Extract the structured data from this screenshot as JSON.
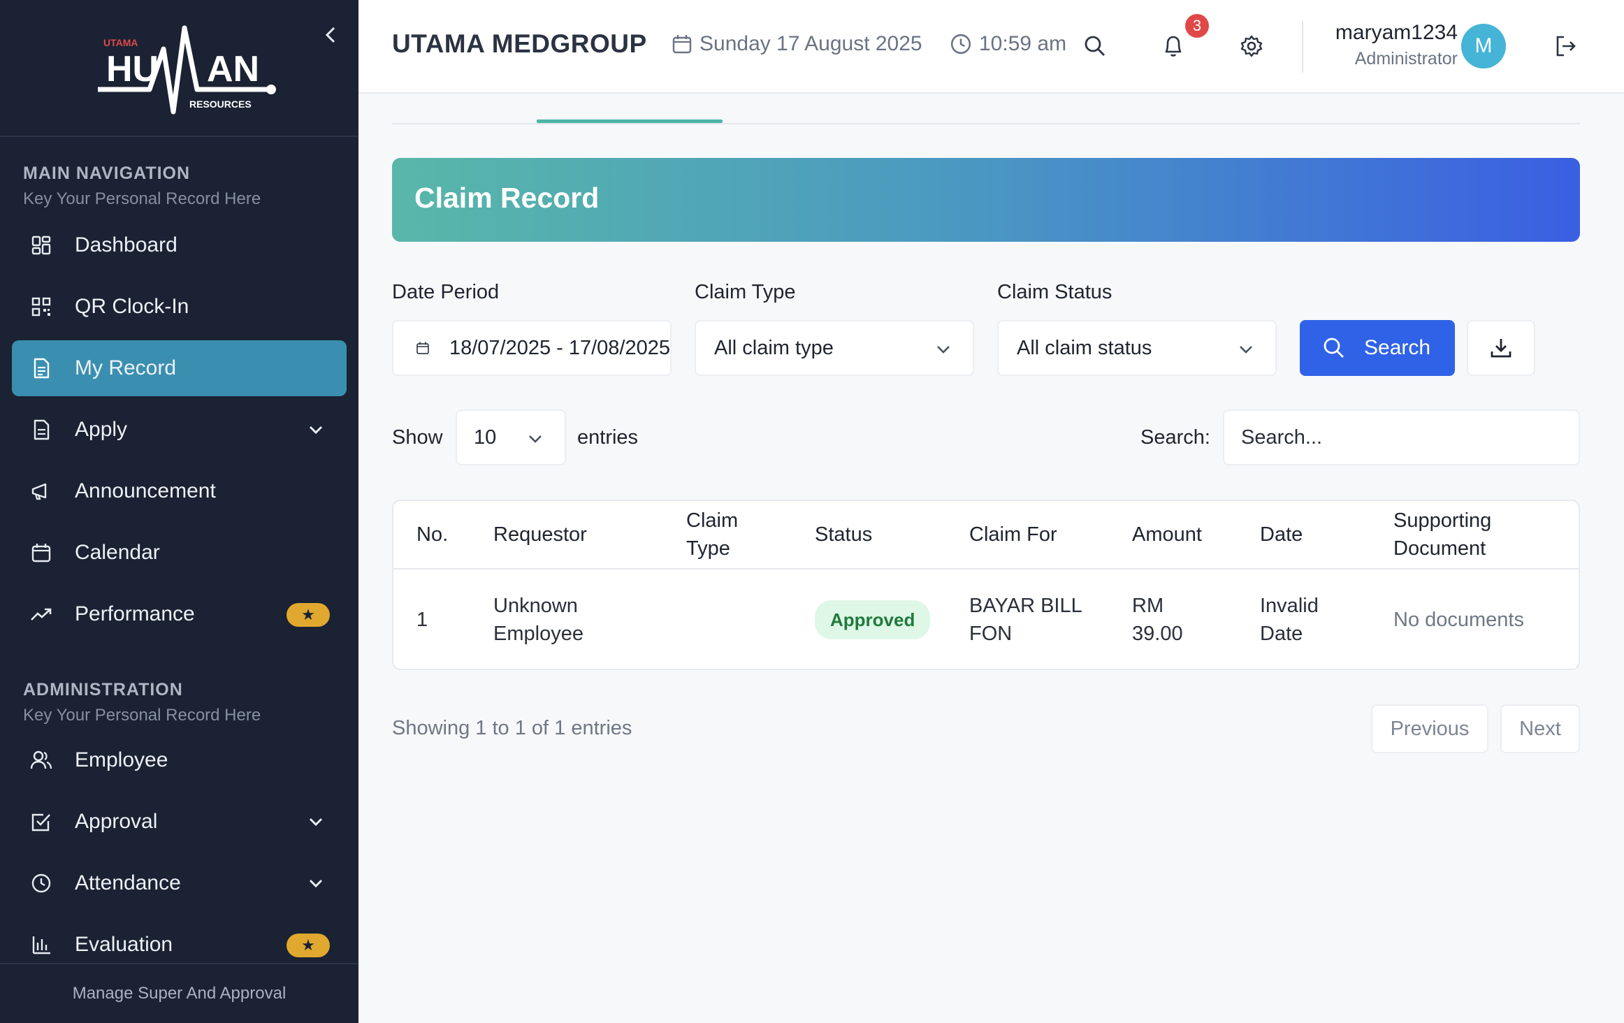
{
  "sidebar": {
    "logo": {
      "small": "UTAMA",
      "main": "HUMAN",
      "sub": "RESOURCES"
    },
    "main_nav": {
      "title": "MAIN NAVIGATION",
      "subtitle": "Key Your Personal Record Here",
      "items": [
        {
          "label": "Dashboard",
          "icon": "dashboard-icon"
        },
        {
          "label": "QR Clock-In",
          "icon": "qr-code-icon"
        },
        {
          "label": "My Record",
          "icon": "document-icon",
          "active": true
        },
        {
          "label": "Apply",
          "icon": "form-icon",
          "expandable": true
        },
        {
          "label": "Announcement",
          "icon": "megaphone-icon"
        },
        {
          "label": "Calendar",
          "icon": "calendar-icon"
        },
        {
          "label": "Performance",
          "icon": "trend-up-icon",
          "badge": "star"
        }
      ]
    },
    "admin_nav": {
      "title": "ADMINISTRATION",
      "subtitle": "Key Your Personal Record Here",
      "items": [
        {
          "label": "Employee",
          "icon": "users-icon"
        },
        {
          "label": "Approval",
          "icon": "checkbox-icon",
          "expandable": true
        },
        {
          "label": "Attendance",
          "icon": "clock-icon",
          "expandable": true
        },
        {
          "label": "Evaluation",
          "icon": "bar-chart-icon",
          "badge": "star"
        }
      ]
    },
    "footer": "Manage Super And Approval"
  },
  "header": {
    "brand": "UTAMA MEDGROUP",
    "date": "Sunday 17 August 2025",
    "time": "10:59 am",
    "notification_count": "3",
    "user": {
      "name": "maryam1234",
      "role": "Administrator",
      "initial": "M"
    }
  },
  "page": {
    "title": "Claim Record",
    "filters": {
      "date_period_label": "Date Period",
      "date_period_value": "18/07/2025 - 17/08/2025",
      "claim_type_label": "Claim Type",
      "claim_type_value": "All claim type",
      "claim_status_label": "Claim Status",
      "claim_status_value": "All claim status",
      "search_button": "Search"
    },
    "table_controls": {
      "show_label": "Show",
      "page_size": "10",
      "entries_label": "entries",
      "search_label": "Search:",
      "search_placeholder": "Search..."
    },
    "table": {
      "headers": [
        "No.",
        "Requestor",
        "Claim Type",
        "Status",
        "Claim For",
        "Amount",
        "Date",
        "Supporting Document"
      ],
      "rows": [
        {
          "no": "1",
          "requestor": "Unknown Employee",
          "claim_type": "",
          "status": "Approved",
          "claim_for": "BAYAR BILL FON",
          "amount": "RM 39.00",
          "date": "Invalid Date",
          "document": "No documents"
        }
      ]
    },
    "pagination": {
      "info": "Showing 1 to 1 of 1 entries",
      "previous": "Previous",
      "next": "Next"
    }
  },
  "colors": {
    "sidebar_bg": "#1a2233",
    "active_item": "#3a8fb0",
    "primary": "#2f62e6",
    "accent": "#4cb5a7",
    "badge": "#e0a82e",
    "approved_bg": "#def7e6"
  }
}
